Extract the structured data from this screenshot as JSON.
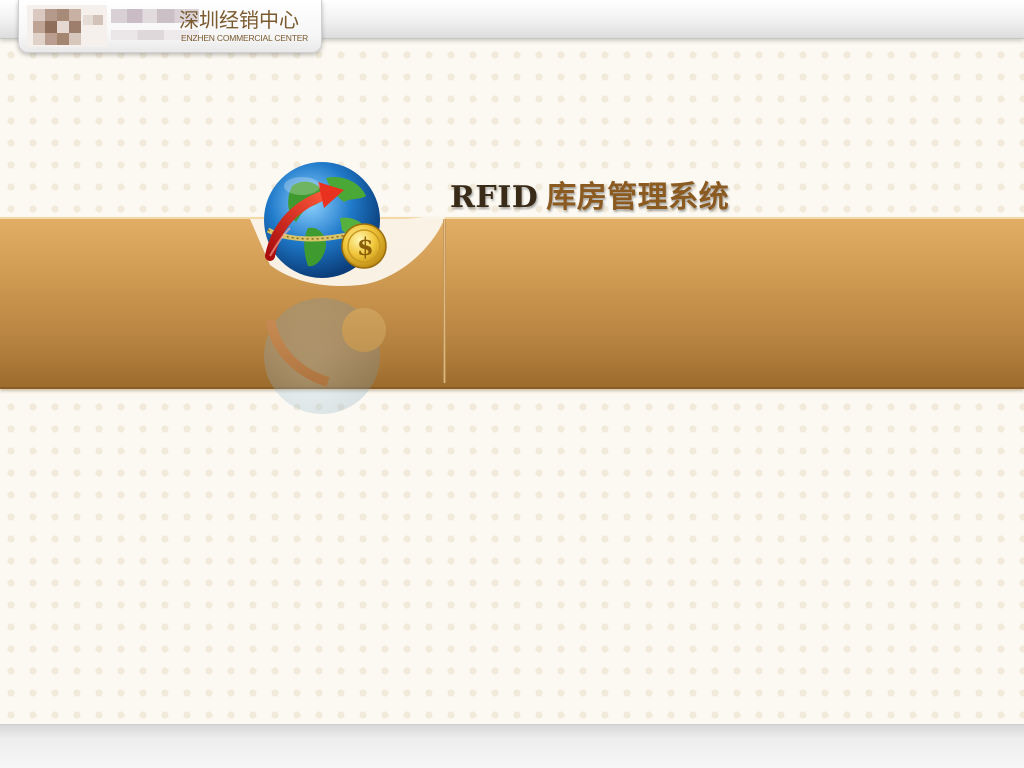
{
  "header": {
    "logo_text_cn": "深圳经销中心",
    "logo_text_en": "ENZHEN COMMERCIAL CENTER"
  },
  "main": {
    "title_en": "RFID",
    "title_cn": "库房管理系统"
  },
  "icons": {
    "logo": "company-logo-icon",
    "globe": "globe-arrow-coin-icon"
  },
  "colors": {
    "band_gold": "#cf9a52",
    "title_brown": "#8a5a20",
    "background": "#fcf9f2"
  }
}
